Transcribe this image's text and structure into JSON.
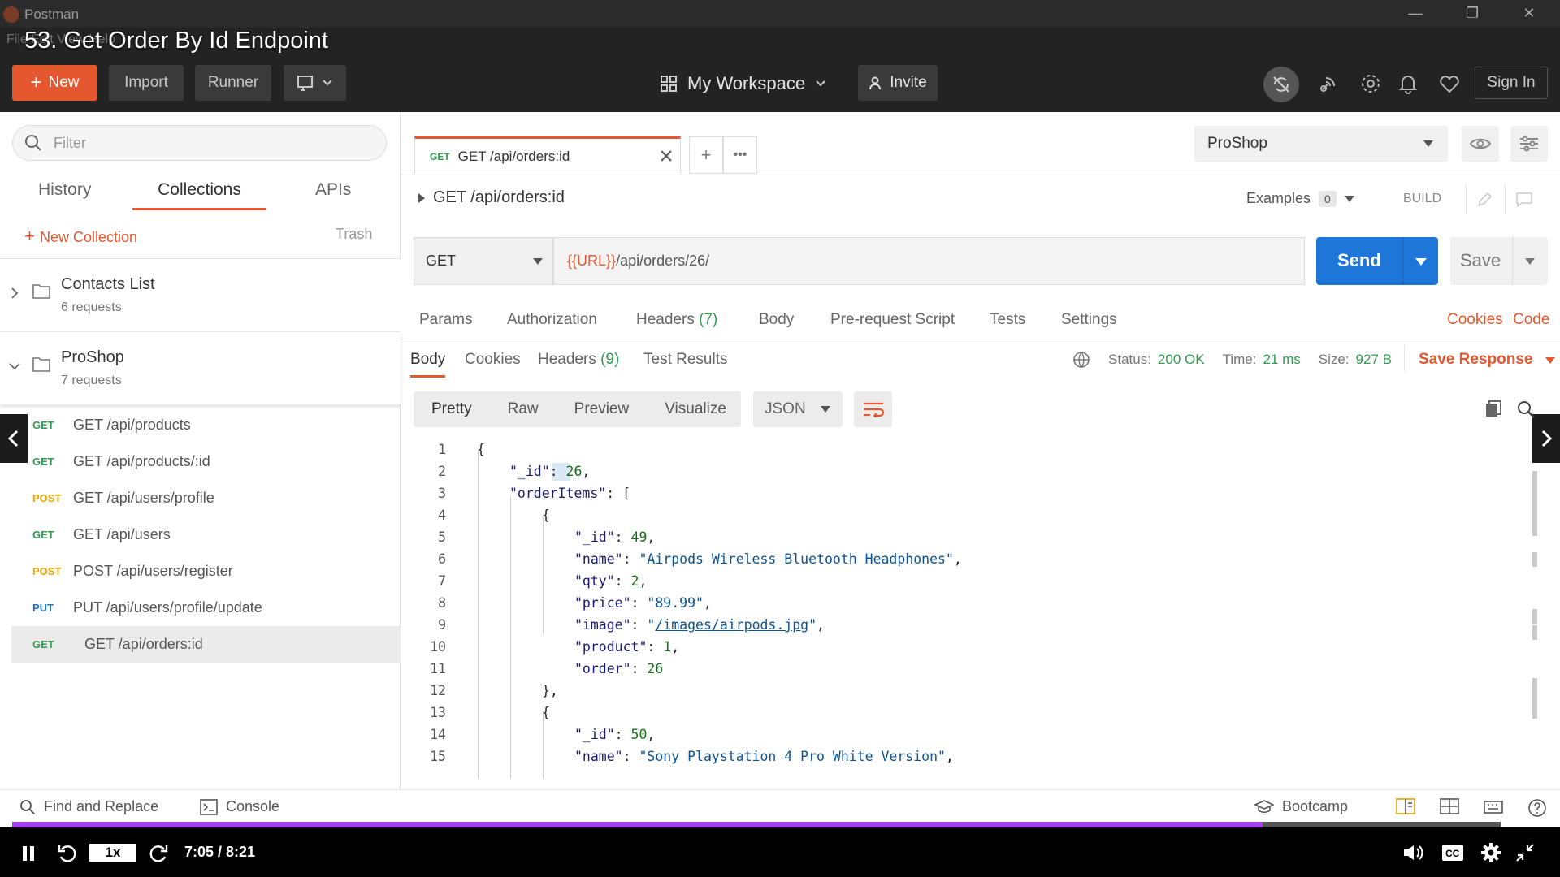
{
  "window": {
    "app_name": "Postman",
    "course_title": "53. Get Order By Id Endpoint",
    "menu_text": "File  Edit  View  Help"
  },
  "header": {
    "new_label": "New",
    "import_label": "Import",
    "runner_label": "Runner",
    "workspace_label": "My Workspace",
    "invite_label": "Invite",
    "signin_label": "Sign In"
  },
  "sidebar": {
    "filter_placeholder": "Filter",
    "tabs": [
      "History",
      "Collections",
      "APIs"
    ],
    "new_collection": "New Collection",
    "trash": "Trash",
    "collections": [
      {
        "name": "Contacts List",
        "count": "6 requests"
      },
      {
        "name": "ProShop",
        "count": "7 requests"
      }
    ],
    "requests": [
      {
        "method": "GET",
        "title": "GET /api/products"
      },
      {
        "method": "GET",
        "title": "GET /api/products/:id"
      },
      {
        "method": "POST",
        "title": "GET /api/users/profile"
      },
      {
        "method": "GET",
        "title": "GET /api/users"
      },
      {
        "method": "POST",
        "title": "POST /api/users/register"
      },
      {
        "method": "PUT",
        "title": "PUT /api/users/profile/update"
      },
      {
        "method": "GET",
        "title": "GET /api/orders:id"
      }
    ]
  },
  "tab": {
    "method": "GET",
    "title": "GET /api/orders:id"
  },
  "environment": {
    "selected": "ProShop"
  },
  "request": {
    "title": "GET /api/orders:id",
    "examples_label": "Examples",
    "examples_count": "0",
    "build_label": "BUILD",
    "method": "GET",
    "url_var": "{{URL}}",
    "url_path": "/api/orders/26/",
    "send_label": "Send",
    "save_label": "Save",
    "tabs": [
      "Params",
      "Authorization",
      "Headers",
      "Body",
      "Pre-request Script",
      "Tests",
      "Settings"
    ],
    "headers_count": "(7)",
    "cookies_link": "Cookies",
    "code_link": "Code"
  },
  "response": {
    "tabs": [
      "Body",
      "Cookies",
      "Headers",
      "Test Results"
    ],
    "headers_count": "(9)",
    "status_label": "Status:",
    "status_value": "200 OK",
    "time_label": "Time:",
    "time_value": "21 ms",
    "size_label": "Size:",
    "size_value": "927 B",
    "save_response": "Save Response",
    "views": [
      "Pretty",
      "Raw",
      "Preview",
      "Visualize"
    ],
    "format": "JSON"
  },
  "code_lines": [
    {
      "n": "1",
      "t": "{"
    },
    {
      "n": "2",
      "t": "\"_id\": 26,"
    },
    {
      "n": "3",
      "t": "\"orderItems\": ["
    },
    {
      "n": "4",
      "t": "{"
    },
    {
      "n": "5",
      "t": "\"_id\": 49,"
    },
    {
      "n": "6",
      "t": "\"name\": \"Airpods Wireless Bluetooth Headphones\","
    },
    {
      "n": "7",
      "t": "\"qty\": 2,"
    },
    {
      "n": "8",
      "t": "\"price\": \"89.99\","
    },
    {
      "n": "9",
      "t": "\"image\": \"/images/airpods.jpg\","
    },
    {
      "n": "10",
      "t": "\"product\": 1,"
    },
    {
      "n": "11",
      "t": "\"order\": 26"
    },
    {
      "n": "12",
      "t": "},"
    },
    {
      "n": "13",
      "t": "{"
    },
    {
      "n": "14",
      "t": "\"_id\": 50,"
    },
    {
      "n": "15",
      "t": "\"name\": \"Sony Playstation 4 Pro White Version\","
    }
  ],
  "footer": {
    "find_replace": "Find and Replace",
    "console": "Console",
    "bootcamp": "Bootcamp"
  },
  "player": {
    "speed": "1x",
    "time": "7:05 / 8:21",
    "progress": 0.84
  }
}
